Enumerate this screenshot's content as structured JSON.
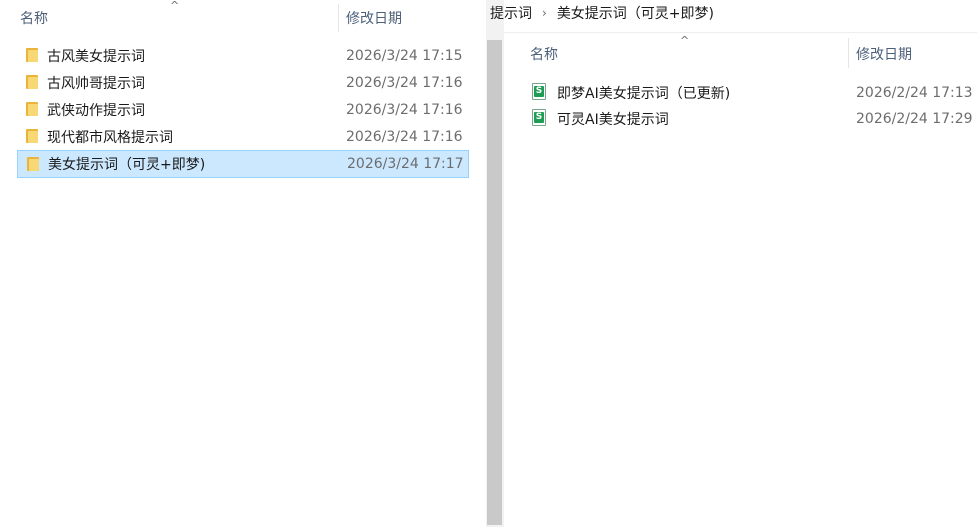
{
  "left": {
    "columns": {
      "name": "名称",
      "modified": "修改日期"
    },
    "sort_indicator": "^",
    "rows": [
      {
        "name": "古风美女提示词",
        "date": "2026/3/24 17:15",
        "icon": "folder-icon"
      },
      {
        "name": "古风帅哥提示词",
        "date": "2026/3/24 17:16",
        "icon": "folder-icon"
      },
      {
        "name": "武侠动作提示词",
        "date": "2026/3/24 17:16",
        "icon": "folder-icon"
      },
      {
        "name": "现代都市风格提示词",
        "date": "2026/3/24 17:16",
        "icon": "folder-icon"
      },
      {
        "name": "美女提示词（可灵+即梦)",
        "date": "2026/3/24 17:17",
        "icon": "folder-icon",
        "selected": true
      }
    ]
  },
  "right": {
    "breadcrumb": {
      "parent": "提示词",
      "separator": "›",
      "current": "美女提示词（可灵+即梦)"
    },
    "columns": {
      "name": "名称",
      "modified": "修改日期"
    },
    "sort_indicator": "^",
    "file_badge": "S",
    "rows": [
      {
        "name": "即梦AI美女提示词（已更新)",
        "date": "2026/2/24 17:13",
        "icon": "spreadsheet-icon"
      },
      {
        "name": "可灵AI美女提示词",
        "date": "2026/2/24 17:29",
        "icon": "spreadsheet-icon"
      }
    ]
  },
  "colors": {
    "selected_bg": "#cce8ff",
    "selected_border": "#99d1ff",
    "folder": "#f8d775",
    "sheet_badge": "#1f9d55"
  }
}
